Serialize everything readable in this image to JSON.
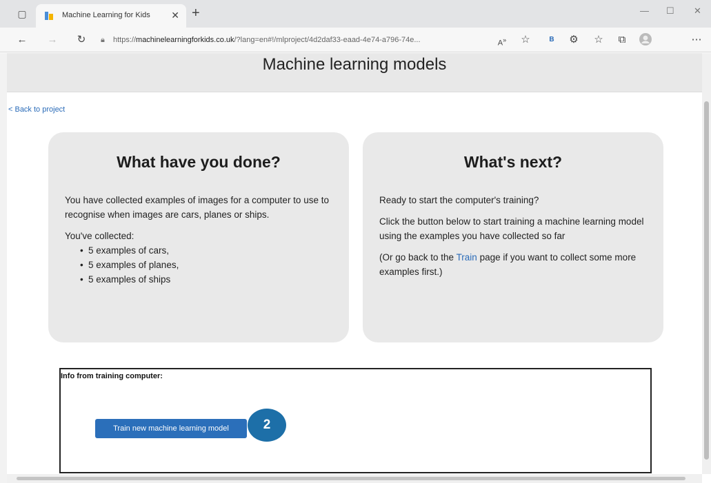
{
  "browser": {
    "tab_title": "Machine Learning for Kids",
    "new_tab": "+",
    "url_scheme": "https://",
    "url_host": "machinelearningforkids.co.uk",
    "url_path": "/?lang=en#!/mlproject/4d2daf33-eaad-4e74-a796-74e..."
  },
  "header": {
    "title": "Machine learning models"
  },
  "nav": {
    "back_label": "< Back to project"
  },
  "left_panel": {
    "heading": "What have you done?",
    "intro": "You have collected examples of images for a computer to use to recognise when images are cars, planes or ships.",
    "collected_label": "You've collected:",
    "items": [
      "5 examples of cars,",
      "5 examples of planes,",
      "5 examples of ships"
    ]
  },
  "right_panel": {
    "heading": "What's next?",
    "p1": "Ready to start the computer's training?",
    "p2": "Click the button below to start training a machine learning model using the examples you have collected so far",
    "p3_before": "(Or go back to the ",
    "p3_link": "Train",
    "p3_after": " page if you want to collect some more examples first.)"
  },
  "training": {
    "label": "Info from training computer:",
    "button_label": "Train new machine learning model",
    "step_badge": "2"
  }
}
